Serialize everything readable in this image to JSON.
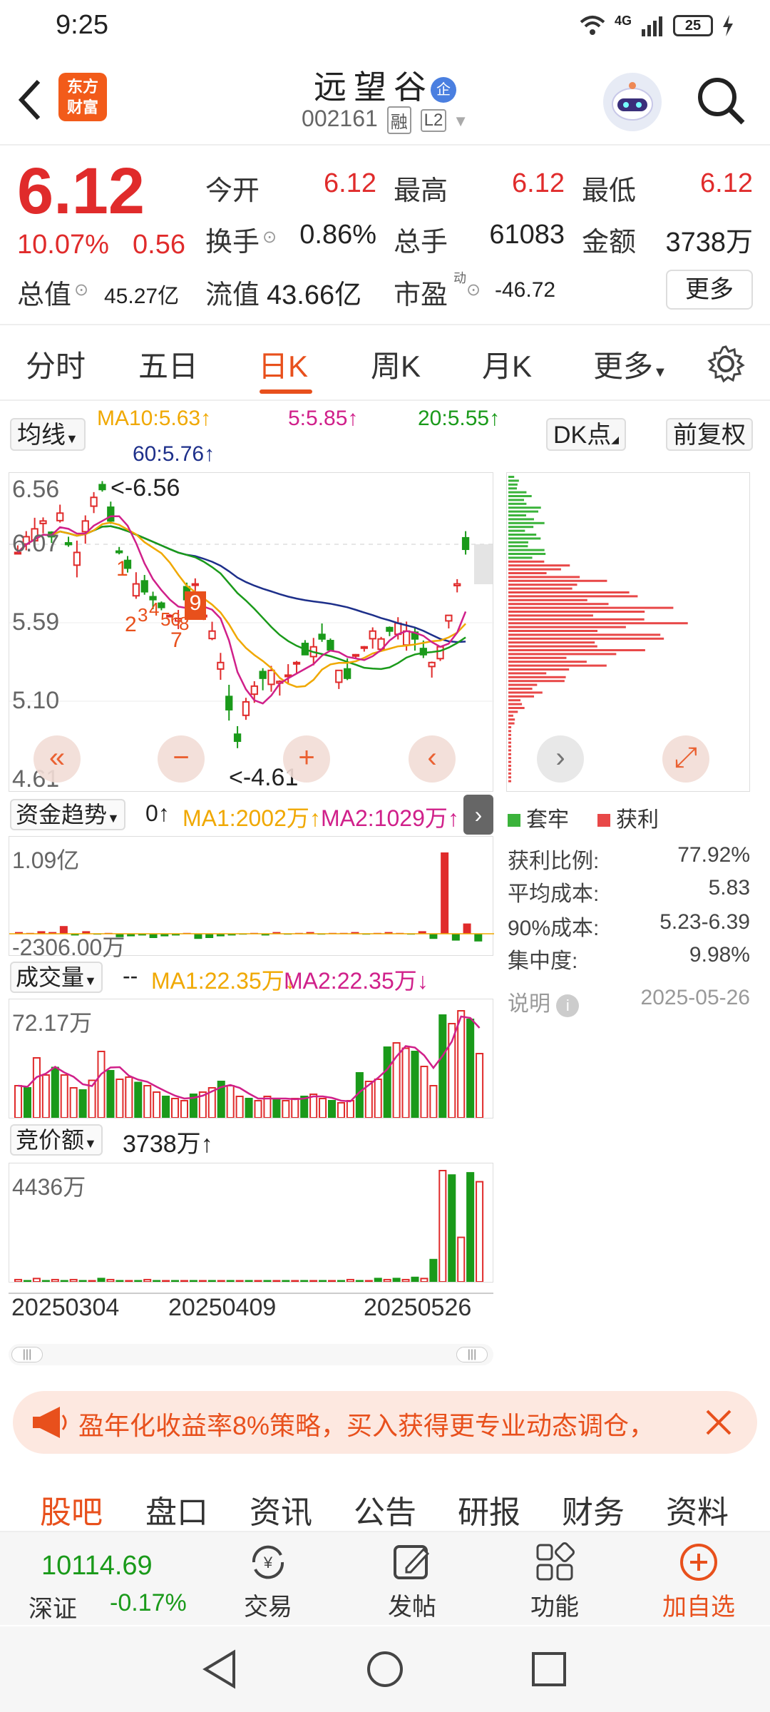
{
  "status": {
    "time": "9:25",
    "network": "4G",
    "battery": "25"
  },
  "header": {
    "logo_line1": "东方",
    "logo_line2": "财富",
    "name": "远望谷",
    "name_badge": "企",
    "code": "002161",
    "tag1": "融",
    "tag2": "L2"
  },
  "quote": {
    "price": "6.12",
    "change_pct": "10.07%",
    "change": "0.56",
    "open_label": "今开",
    "open": "6.12",
    "high_label": "最高",
    "high": "6.12",
    "low_label": "最低",
    "low": "6.12",
    "turnover_label": "换手",
    "turnover": "0.86%",
    "volume_label": "总手",
    "volume": "61083",
    "amount_label": "金额",
    "amount": "3738万",
    "total_cap_label": "总值",
    "total_cap": "45.27亿",
    "float_cap_label": "流值",
    "float_cap": "43.66亿",
    "pe_label": "市盈",
    "pe_sup": "动",
    "pe": "-46.72",
    "more": "更多"
  },
  "tabs": [
    "分时",
    "五日",
    "日K",
    "周K",
    "月K",
    "更多"
  ],
  "kline": {
    "ma_selector": "均线",
    "ma10": "MA10:5.63↑",
    "ma5": "5:5.85↑",
    "ma20": "20:5.55↑",
    "ma60": "60:5.76↑",
    "dk_btn": "DK点",
    "adj_btn": "前复权",
    "y_labels": [
      "6.56",
      "6.07",
      "5.59",
      "5.10",
      "4.61"
    ],
    "high_mark": "<-6.56",
    "low_mark": "<-4.61",
    "signals": [
      "1",
      "2",
      "3",
      "4",
      "5",
      "6",
      "7",
      "8",
      "9"
    ]
  },
  "chip_dist": {
    "legend_trapped": "套牢",
    "legend_profit": "获利",
    "profit_ratio_label": "获利比例:",
    "profit_ratio": "77.92%",
    "avg_cost_label": "平均成本:",
    "avg_cost": "5.83",
    "cost90_label": "90%成本:",
    "cost90": "5.23-6.39",
    "concentration_label": "集中度:",
    "concentration": "9.98%",
    "note_label": "说明",
    "date": "2025-05-26",
    "colors": {
      "trapped": "#3bb33b",
      "profit": "#e84848"
    }
  },
  "fund": {
    "selector": "资金趋势",
    "value": "0↑",
    "ma1": "MA1:2002万↑",
    "ma2": "MA2:1029万↑",
    "top": "1.09亿",
    "bottom": "-2306.00万",
    "values": [
      0.2,
      0.1,
      0.3,
      0.2,
      0.9,
      -0.2,
      0.3,
      -0.1,
      0.1,
      -0.4,
      -0.3,
      -0.2,
      -0.5,
      -0.3,
      -0.2,
      0.1,
      -0.6,
      -0.5,
      -0.3,
      -0.2,
      -0.1,
      0.1,
      -0.2,
      0.2,
      -0.1,
      0.1,
      0.2,
      -0.1,
      0.1,
      0.1,
      0.2,
      -0.1,
      0.1,
      0.2,
      0.1,
      -0.1,
      0.3,
      -0.6,
      9.5,
      -0.8,
      1.2,
      -0.9
    ]
  },
  "volume": {
    "selector": "成交量",
    "value": "--",
    "ma1": "MA1:22.35万↓",
    "ma2": "MA2:22.35万↓",
    "top": "72.17万",
    "values": [
      30,
      28,
      56,
      40,
      47,
      40,
      28,
      26,
      35,
      62,
      44,
      36,
      38,
      33,
      30,
      24,
      20,
      18,
      16,
      22,
      24,
      28,
      34,
      30,
      20,
      18,
      16,
      20,
      18,
      16,
      18,
      20,
      22,
      18,
      16,
      14,
      16,
      42,
      34,
      36,
      66,
      70,
      65,
      62,
      48,
      30,
      96,
      88,
      100,
      92,
      60
    ]
  },
  "auction": {
    "selector": "竞价额",
    "value": "3738万↑",
    "top": "4436万",
    "dates": [
      "20250304",
      "20250409",
      "20250526"
    ]
  },
  "banner": {
    "text": "盈年化收益率8%策略，买入获得更专业动态调仓，"
  },
  "bottom_tabs": [
    "股吧",
    "盘口",
    "资讯",
    "公告",
    "研报",
    "财务",
    "资料"
  ],
  "toolbar": {
    "index_value": "10114.69",
    "index_name": "深证",
    "index_change": "-0.17%",
    "trade": "交易",
    "post": "发帖",
    "function": "功能",
    "add_watch": "加自选"
  }
}
